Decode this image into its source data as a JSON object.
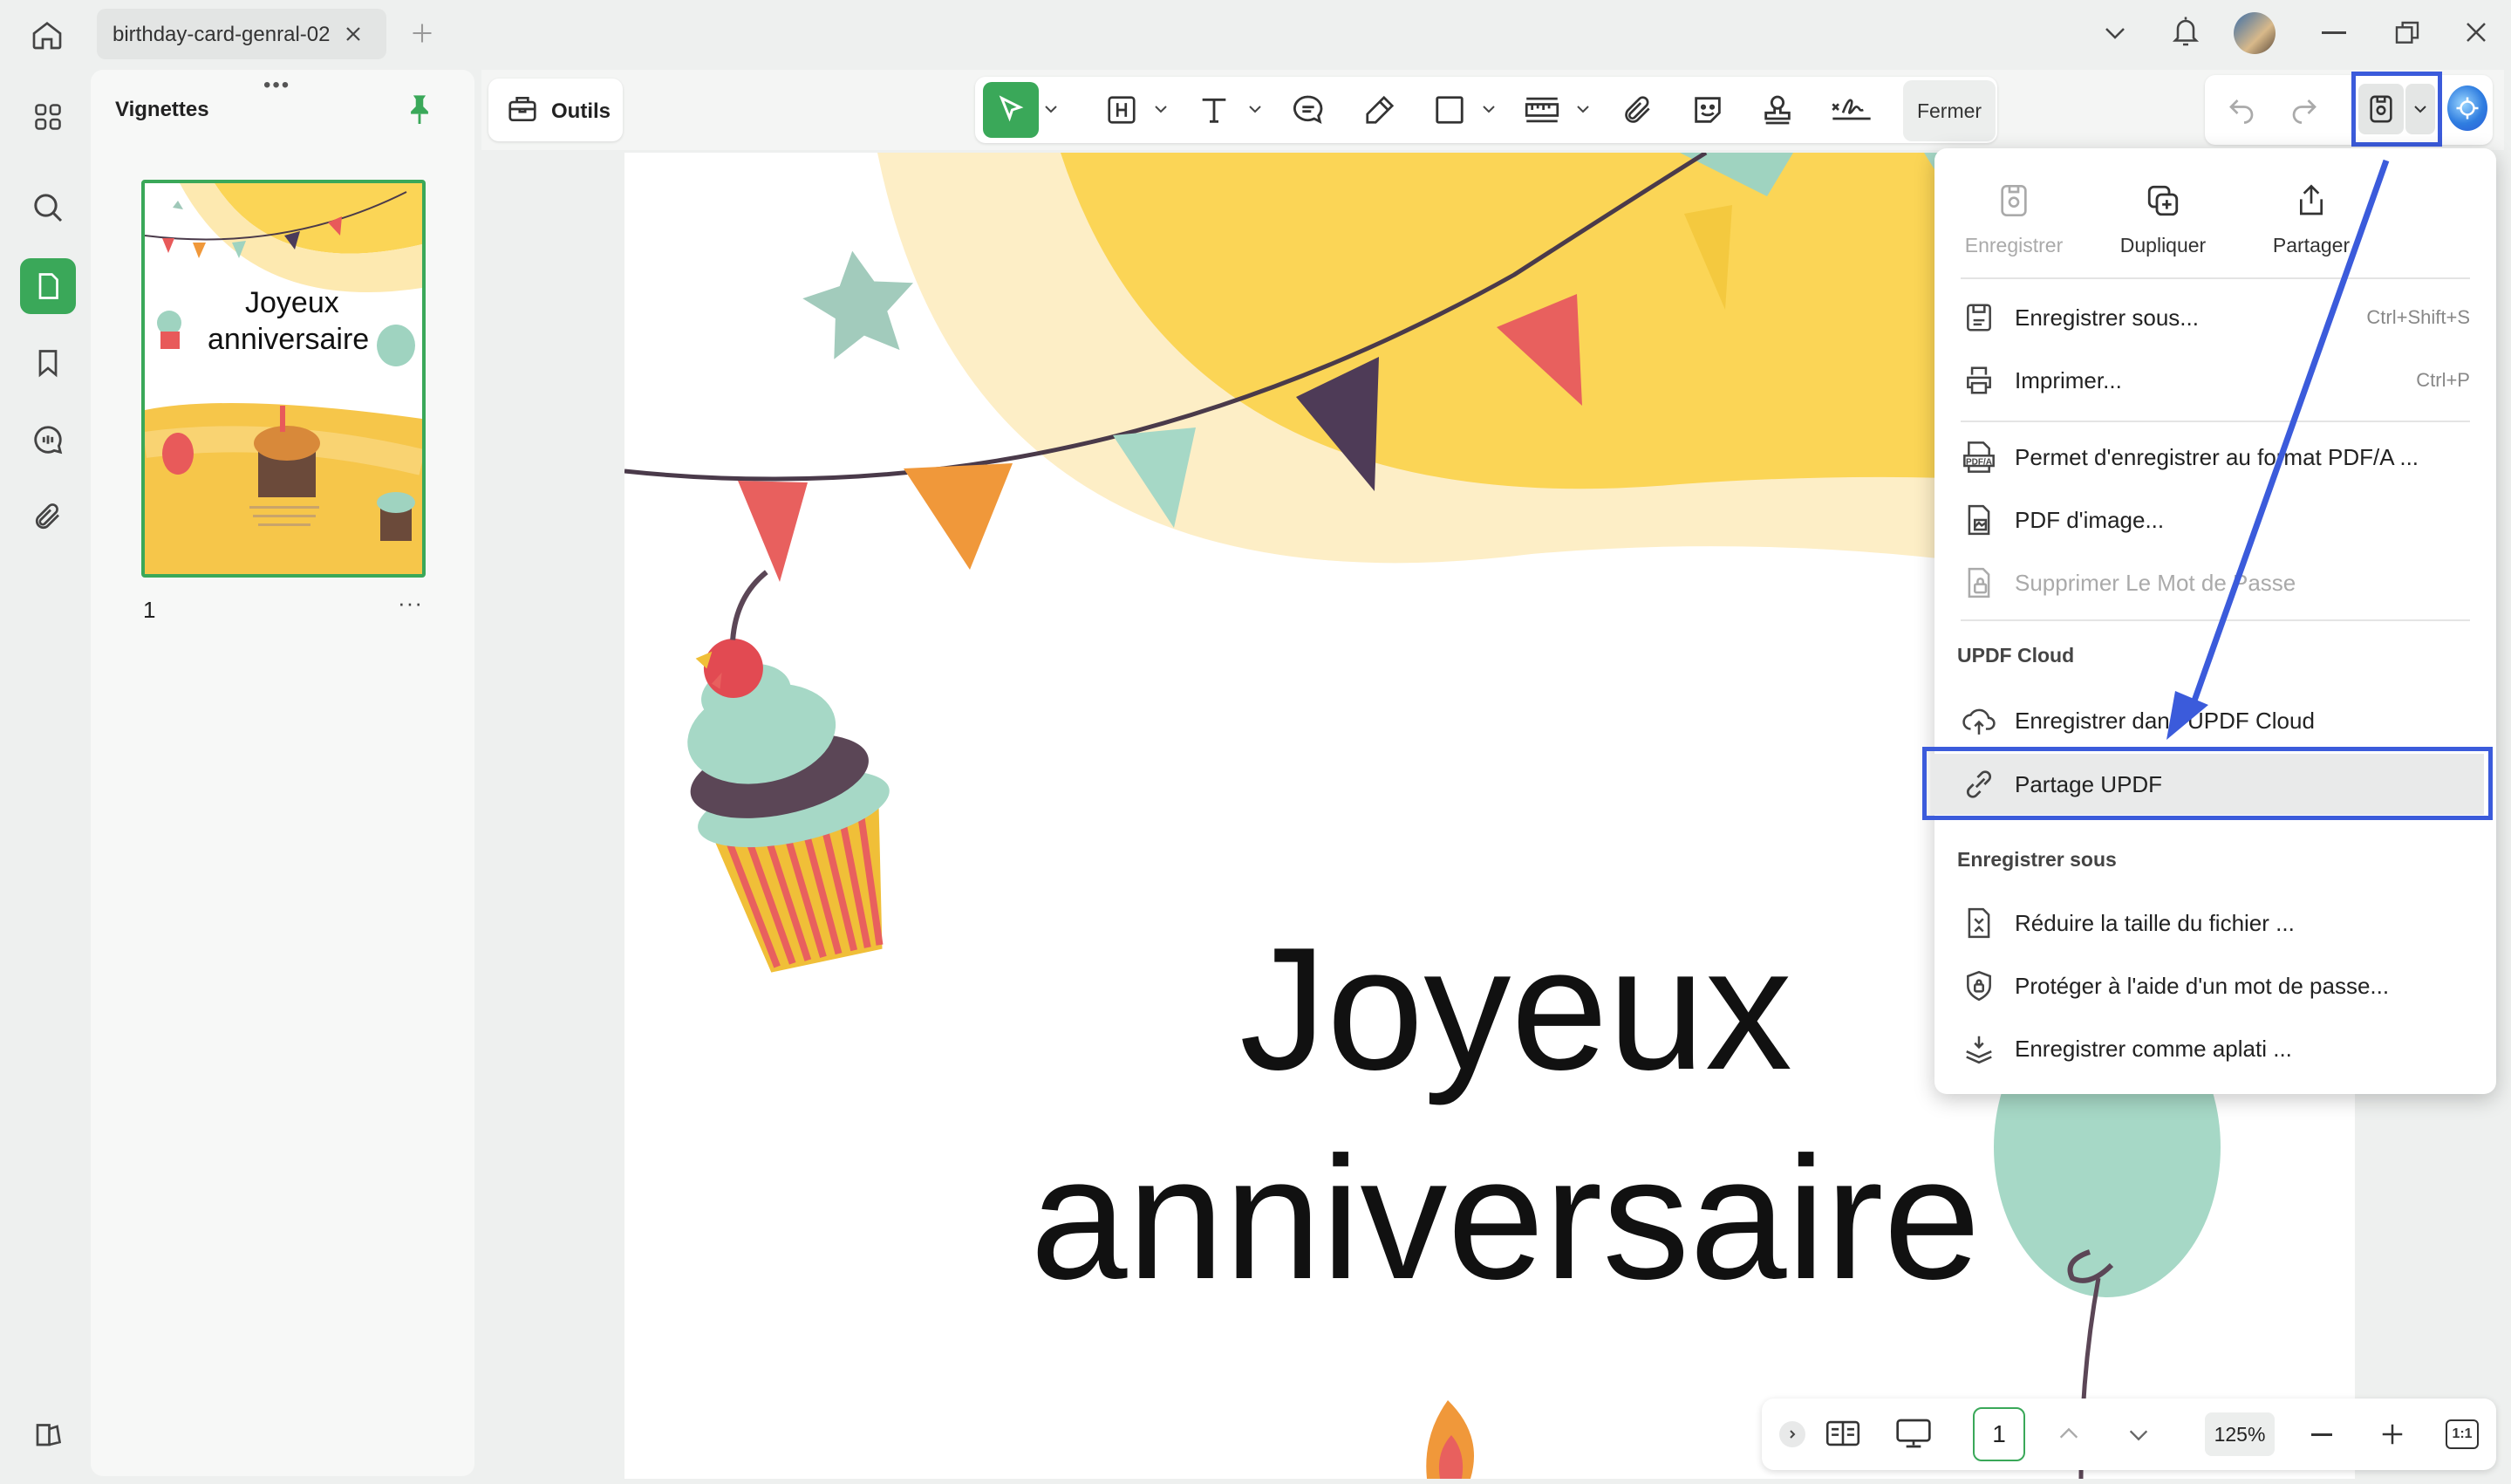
{
  "window": {
    "tab_title": "birthday-card-genral-02"
  },
  "sidebar": {
    "panel_title": "Vignettes",
    "page_number": "1",
    "thumbnail_title_line1": "Joyeux",
    "thumbnail_title_line2": "anniversaire"
  },
  "toolbar": {
    "tools_label": "Outils",
    "close_label": "Fermer"
  },
  "document": {
    "title_line1": "Joyeux",
    "title_line2": "anniversaire"
  },
  "menu": {
    "top_buttons": [
      {
        "label": "Enregistrer",
        "icon": "save-icon",
        "enabled": false
      },
      {
        "label": "Dupliquer",
        "icon": "duplicate-icon",
        "enabled": true
      },
      {
        "label": "Partager",
        "icon": "share-icon",
        "enabled": true
      }
    ],
    "group1": [
      {
        "label": "Enregistrer sous...",
        "shortcut": "Ctrl+Shift+S",
        "icon": "save-as-icon"
      },
      {
        "label": "Imprimer...",
        "shortcut": "Ctrl+P",
        "icon": "printer-icon"
      }
    ],
    "group2": [
      {
        "label": "Permet d'enregistrer au format PDF/A ...",
        "icon": "pdfa-icon",
        "enabled": true
      },
      {
        "label": "PDF d'image...",
        "icon": "image-pdf-icon",
        "enabled": true
      },
      {
        "label": "Supprimer Le Mot de Passe",
        "icon": "remove-password-icon",
        "enabled": false
      }
    ],
    "cloud_section": "UPDF Cloud",
    "cloud_items": [
      {
        "label": "Enregistrer dans UPDF Cloud",
        "icon": "cloud-upload-icon"
      },
      {
        "label": "Partage UPDF",
        "icon": "link-icon"
      }
    ],
    "save_section": "Enregistrer sous",
    "save_items": [
      {
        "label": "Réduire la taille du fichier ...",
        "icon": "compress-icon"
      },
      {
        "label": "Protéger à l'aide d'un mot de passe...",
        "icon": "shield-lock-icon"
      },
      {
        "label": "Enregistrer comme aplati ...",
        "icon": "flatten-icon"
      }
    ]
  },
  "bottom": {
    "page_input": "1",
    "zoom": "125%"
  },
  "colors": {
    "accent_green": "#3aa859",
    "highlight_blue": "#3b5bdb",
    "banner_yellow": "#fbd556"
  }
}
